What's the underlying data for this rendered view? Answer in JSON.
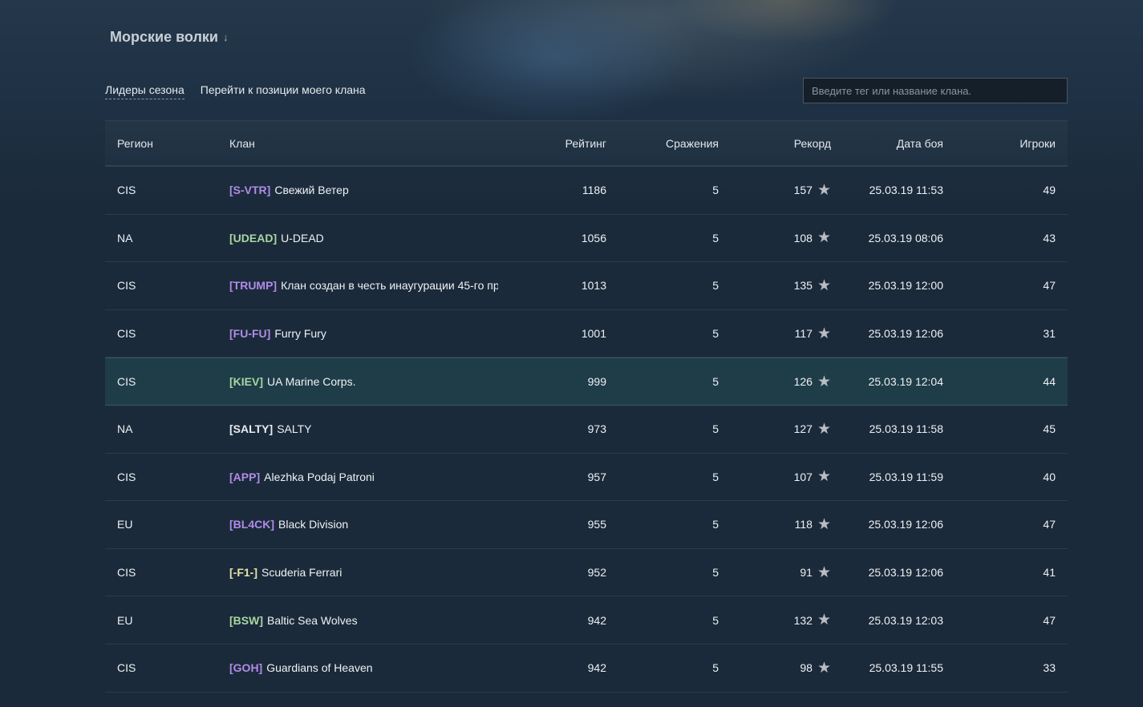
{
  "season_title": "Морские волки",
  "tabs": [
    "Лидеры сезона",
    "Перейти к позиции моего клана"
  ],
  "search": {
    "placeholder": "Введите тег или название клана.",
    "value": ""
  },
  "columns": {
    "region": "Регион",
    "clan": "Клан",
    "rating": "Рейтинг",
    "battles": "Сражения",
    "record": "Рекорд",
    "date": "Дата боя",
    "players": "Игроки"
  },
  "icons": {
    "record": "star-icon",
    "sort": "arrow-down-icon"
  },
  "colors": {
    "tag_purple": "#b08ce8",
    "tag_green": "#a9d6a2",
    "tag_white": "#e8ecef",
    "tag_yellow": "#e8e2a8",
    "highlight_row": "#1f3d48"
  },
  "rows": [
    {
      "region": "CIS",
      "tag": "[S-VTR]",
      "tag_color": "purple",
      "name": "Свежий Ветер",
      "rating": "1186",
      "battles": "5",
      "record": "157",
      "date": "25.03.19 11:53",
      "players": "49",
      "highlight": false
    },
    {
      "region": "NA",
      "tag": "[UDEAD]",
      "tag_color": "green",
      "name": "U-DEAD",
      "rating": "1056",
      "battles": "5",
      "record": "108",
      "date": "25.03.19 08:06",
      "players": "43",
      "highlight": false
    },
    {
      "region": "CIS",
      "tag": "[TRUMP]",
      "tag_color": "purple",
      "name": "Клан создан в честь инаугурации 45-го пр…",
      "rating": "1013",
      "battles": "5",
      "record": "135",
      "date": "25.03.19 12:00",
      "players": "47",
      "highlight": false
    },
    {
      "region": "CIS",
      "tag": "[FU-FU]",
      "tag_color": "purple",
      "name": "Furry Fury",
      "rating": "1001",
      "battles": "5",
      "record": "117",
      "date": "25.03.19 12:06",
      "players": "31",
      "highlight": false
    },
    {
      "region": "CIS",
      "tag": "[KIEV]",
      "tag_color": "green",
      "name": "UA Marine Corps.",
      "rating": "999",
      "battles": "5",
      "record": "126",
      "date": "25.03.19 12:04",
      "players": "44",
      "highlight": true
    },
    {
      "region": "NA",
      "tag": "[SALTY]",
      "tag_color": "white",
      "name": "SALTY",
      "rating": "973",
      "battles": "5",
      "record": "127",
      "date": "25.03.19 11:58",
      "players": "45",
      "highlight": false
    },
    {
      "region": "CIS",
      "tag": "[APP]",
      "tag_color": "purple",
      "name": "Alezhka Podaj Patroni",
      "rating": "957",
      "battles": "5",
      "record": "107",
      "date": "25.03.19 11:59",
      "players": "40",
      "highlight": false
    },
    {
      "region": "EU",
      "tag": "[BL4CK]",
      "tag_color": "purple",
      "name": "Black Division",
      "rating": "955",
      "battles": "5",
      "record": "118",
      "date": "25.03.19 12:06",
      "players": "47",
      "highlight": false
    },
    {
      "region": "CIS",
      "tag": "[-F1-]",
      "tag_color": "yellow",
      "name": "Scuderia Ferrari",
      "rating": "952",
      "battles": "5",
      "record": "91",
      "date": "25.03.19 12:06",
      "players": "41",
      "highlight": false
    },
    {
      "region": "EU",
      "tag": "[BSW]",
      "tag_color": "green",
      "name": "Baltic Sea Wolves",
      "rating": "942",
      "battles": "5",
      "record": "132",
      "date": "25.03.19 12:03",
      "players": "47",
      "highlight": false
    },
    {
      "region": "CIS",
      "tag": "[GOH]",
      "tag_color": "purple",
      "name": "Guardians of Heaven",
      "rating": "942",
      "battles": "5",
      "record": "98",
      "date": "25.03.19 11:55",
      "players": "33",
      "highlight": false
    }
  ]
}
